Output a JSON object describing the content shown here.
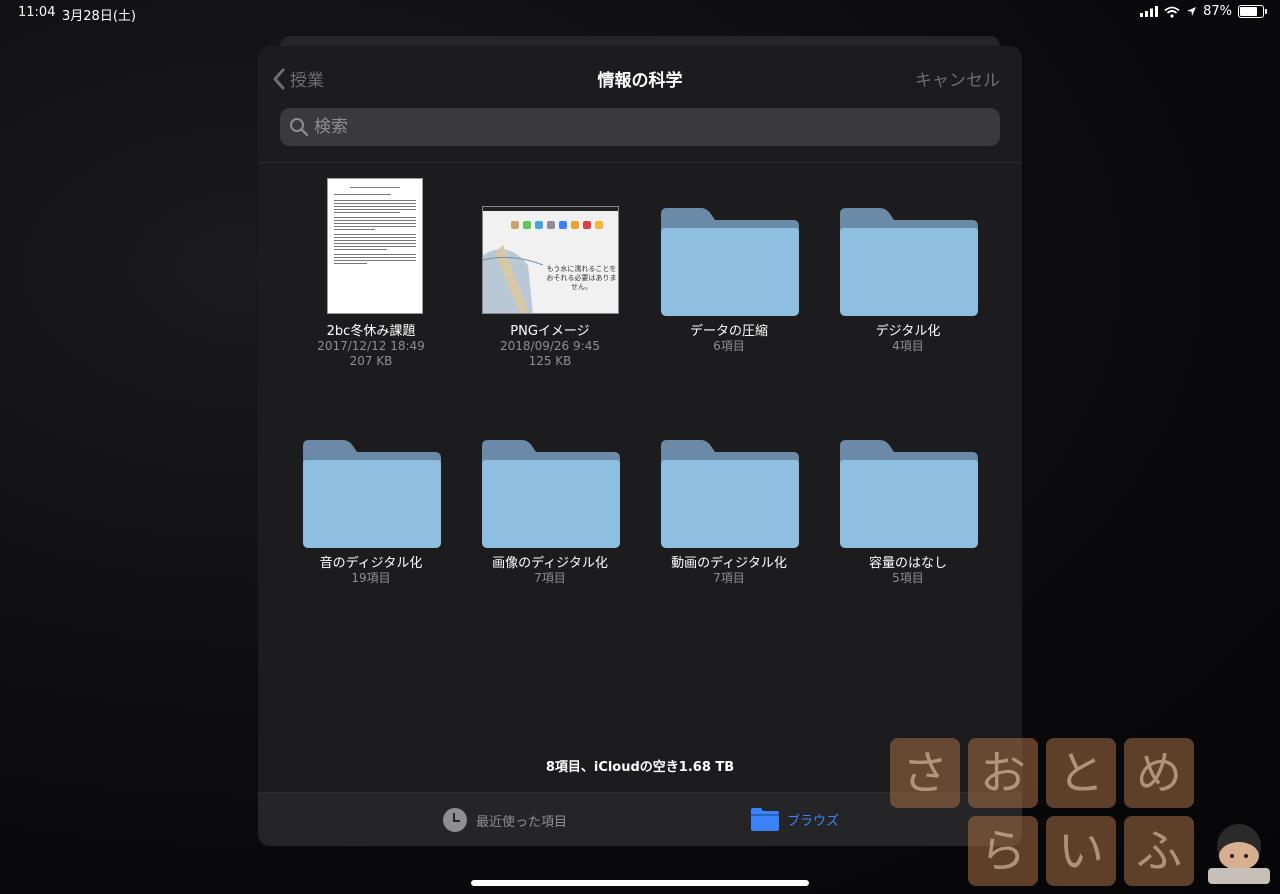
{
  "status": {
    "time": "11:04",
    "date": "3月28日(土)",
    "battery": "87%",
    "battery_level": 0.87
  },
  "nav": {
    "back_label": "授業",
    "title": "情報の科学",
    "cancel_label": "キャンセル"
  },
  "search": {
    "placeholder": "検索"
  },
  "items": [
    {
      "name": "2bc冬休み課題",
      "date": "2017/12/12 18:49",
      "size": "207 KB",
      "kind": "document"
    },
    {
      "name": "PNGイメージ",
      "date": "2018/09/26 9:45",
      "size": "125 KB",
      "kind": "image"
    },
    {
      "name": "データの圧縮",
      "count": "6項目",
      "kind": "folder"
    },
    {
      "name": "デジタル化",
      "count": "4項目",
      "kind": "folder"
    },
    {
      "name": "音のディジタル化",
      "count": "19項目",
      "kind": "folder"
    },
    {
      "name": "画像のディジタル化",
      "count": "7項目",
      "kind": "folder"
    },
    {
      "name": "動画のディジタル化",
      "count": "7項目",
      "kind": "folder"
    },
    {
      "name": "容量のはなし",
      "count": "5項目",
      "kind": "folder"
    }
  ],
  "png_thumb_text": [
    "もう水に濡れることを",
    "おそれる必要はありません。"
  ],
  "summary": "8項目、iCloudの空き1.68 TB",
  "tabs": {
    "recent": "最近使った項目",
    "browse": "ブラウズ"
  },
  "watermark": {
    "row1": [
      "さ",
      "お",
      "と",
      "め"
    ],
    "row2": [
      "ら",
      "い",
      "ふ"
    ]
  },
  "colors": {
    "accent": "#3a82f7",
    "folder": "#8fbfe0",
    "sheet": "#1c1c1e"
  }
}
